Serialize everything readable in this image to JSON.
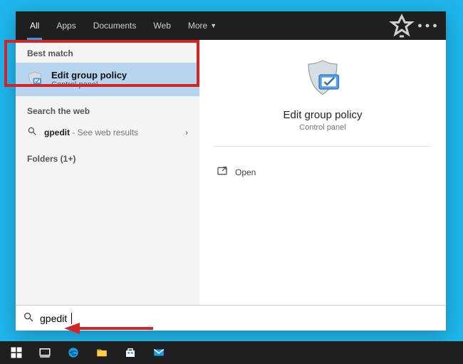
{
  "filters": {
    "all": "All",
    "apps": "Apps",
    "documents": "Documents",
    "web": "Web",
    "more": "More"
  },
  "left": {
    "best_match_header": "Best match",
    "best_match": {
      "title": "Edit group policy",
      "subtitle": "Control panel"
    },
    "search_web_header": "Search the web",
    "web_row": {
      "term": "gpedit",
      "tail": " - See web results"
    },
    "folders_header": "Folders (1+)"
  },
  "preview": {
    "title": "Edit group policy",
    "subtitle": "Control panel",
    "open_label": "Open"
  },
  "search": {
    "query": "gpedit"
  }
}
